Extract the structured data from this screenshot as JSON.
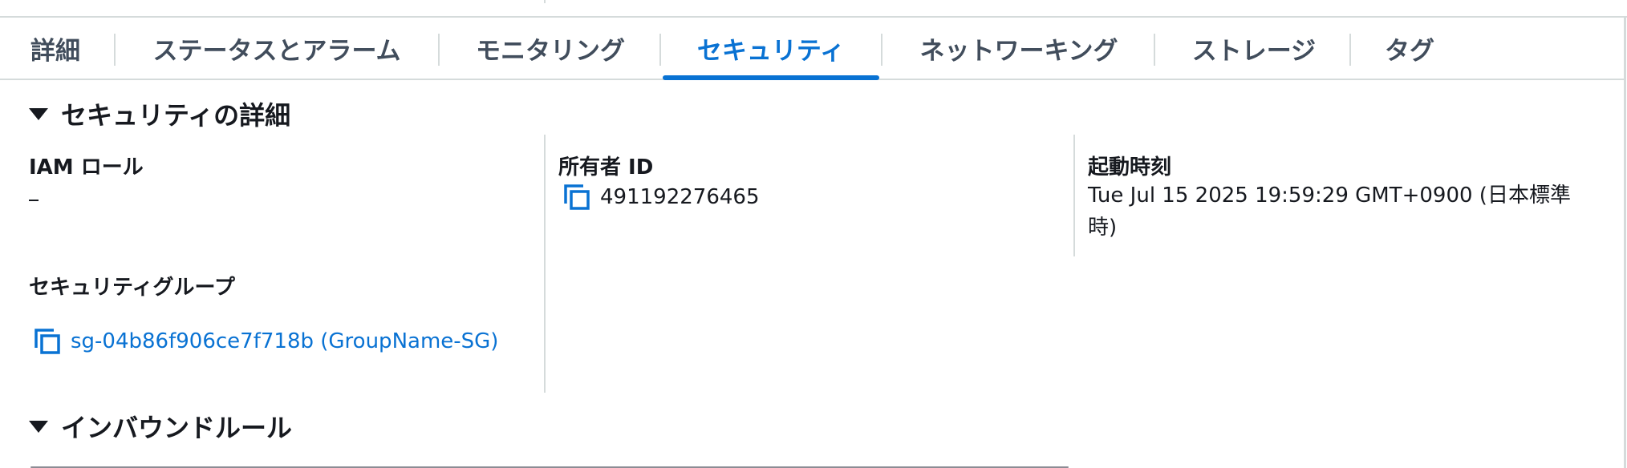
{
  "tabs": [
    {
      "label": "詳細",
      "active": false
    },
    {
      "label": "ステータスとアラーム",
      "active": false
    },
    {
      "label": "モニタリング",
      "active": false
    },
    {
      "label": "セキュリティ",
      "active": true
    },
    {
      "label": "ネットワーキング",
      "active": false
    },
    {
      "label": "ストレージ",
      "active": false
    },
    {
      "label": "タグ",
      "active": false
    }
  ],
  "security_details": {
    "title": "セキュリティの詳細",
    "iam_role": {
      "label": "IAM ロール",
      "value": "–"
    },
    "owner_id": {
      "label": "所有者 ID",
      "value": "491192276465",
      "icon": "copy-icon"
    },
    "launch_time": {
      "label": "起動時刻",
      "value": "Tue Jul 15 2025 19:59:29 GMT+0900 (日本標準時)"
    },
    "security_groups": {
      "label": "セキュリティグループ",
      "items": [
        {
          "text": "sg-04b86f906ce7f718b (GroupName-SG)",
          "icon": "copy-icon"
        }
      ]
    }
  },
  "inbound_rules": {
    "title": "インバウンドルール"
  },
  "colors": {
    "accent": "#0972d3",
    "text": "#16191f",
    "tab_text": "#414d5c",
    "divider": "#d5dbdb"
  }
}
